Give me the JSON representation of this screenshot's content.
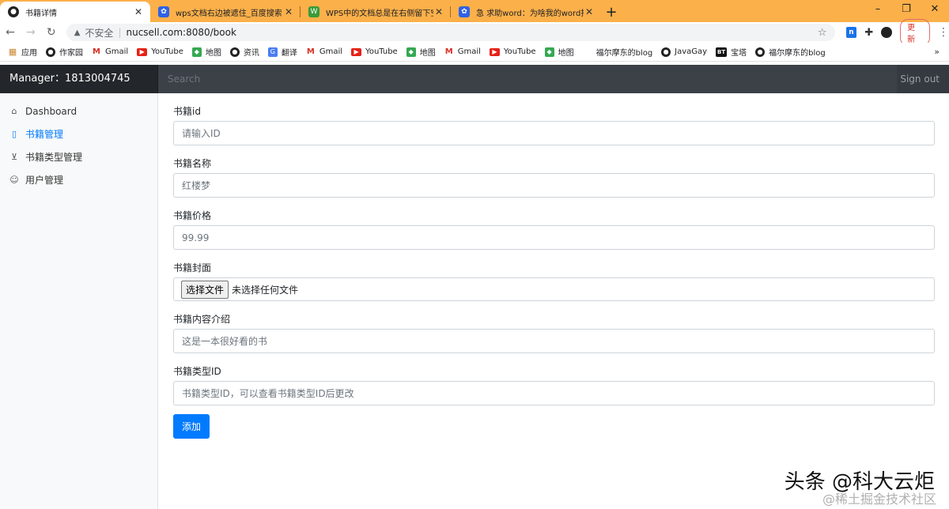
{
  "browser": {
    "tabs": [
      {
        "title": "书籍详情",
        "icon": "github-icon",
        "active": true
      },
      {
        "title": "wps文档右边被遮住_百度搜索",
        "icon": "baidu-paw-icon",
        "active": false
      },
      {
        "title": "WPS中的文档总是在右侧留下空白",
        "icon": "wps-icon",
        "active": false
      },
      {
        "title": "急 求助word：为啥我的word打开",
        "icon": "baidu-paw-icon",
        "active": false
      }
    ],
    "new_tab": "+",
    "window_controls": [
      "–",
      "❐",
      "✕"
    ],
    "address": {
      "security_label": "不安全",
      "url": "nucsell.com:8080/book"
    },
    "update_label": "更新",
    "bookmarks": [
      {
        "label": "应用",
        "icon": "apps-grid-icon"
      },
      {
        "label": "作家园",
        "icon": "github-icon"
      },
      {
        "label": "Gmail",
        "icon": "gmail-icon"
      },
      {
        "label": "YouTube",
        "icon": "youtube-icon"
      },
      {
        "label": "地图",
        "icon": "maps-icon"
      },
      {
        "label": "资讯",
        "icon": "github-icon"
      },
      {
        "label": "翻译",
        "icon": "translate-icon"
      },
      {
        "label": "Gmail",
        "icon": "gmail-icon"
      },
      {
        "label": "YouTube",
        "icon": "youtube-icon"
      },
      {
        "label": "地图",
        "icon": "maps-icon"
      },
      {
        "label": "Gmail",
        "icon": "gmail-icon"
      },
      {
        "label": "YouTube",
        "icon": "youtube-icon"
      },
      {
        "label": "地图",
        "icon": "maps-icon"
      },
      {
        "label": "福尔摩东的blog",
        "icon": "blank-page-icon"
      },
      {
        "label": "JavaGay",
        "icon": "github-icon"
      },
      {
        "label": "宝塔",
        "icon": "bt-icon"
      },
      {
        "label": "福尔摩东的blog",
        "icon": "github-icon"
      }
    ],
    "bookmarks_more": "»"
  },
  "navbar": {
    "brand": "Manager：1813004745",
    "search_placeholder": "Search",
    "signout": "Sign out"
  },
  "sidebar": {
    "items": [
      {
        "label": "Dashboard",
        "icon": "home-icon",
        "active": false
      },
      {
        "label": "书籍管理",
        "icon": "file-icon",
        "active": true
      },
      {
        "label": "书籍类型管理",
        "icon": "cart-icon",
        "active": false
      },
      {
        "label": "用户管理",
        "icon": "users-icon",
        "active": false
      }
    ]
  },
  "form": {
    "id_label": "书籍id",
    "id_placeholder": "请输入ID",
    "name_label": "书籍名称",
    "name_placeholder": "红楼梦",
    "price_label": "书籍价格",
    "price_placeholder": "99.99",
    "cover_label": "书籍封面",
    "cover_button": "选择文件",
    "cover_status": "未选择任何文件",
    "desc_label": "书籍内容介绍",
    "desc_placeholder": "这是一本很好看的书",
    "type_label": "书籍类型ID",
    "type_placeholder": "书籍类型ID，可以查看书籍类型ID后更改",
    "submit_label": "添加"
  },
  "watermark": {
    "main": "头条 @科大云炬",
    "sub": "@稀土掘金技术社区"
  },
  "colors": {
    "tabstrip": "#fbb04a",
    "navbar": "#343a40",
    "primary": "#007bff"
  }
}
